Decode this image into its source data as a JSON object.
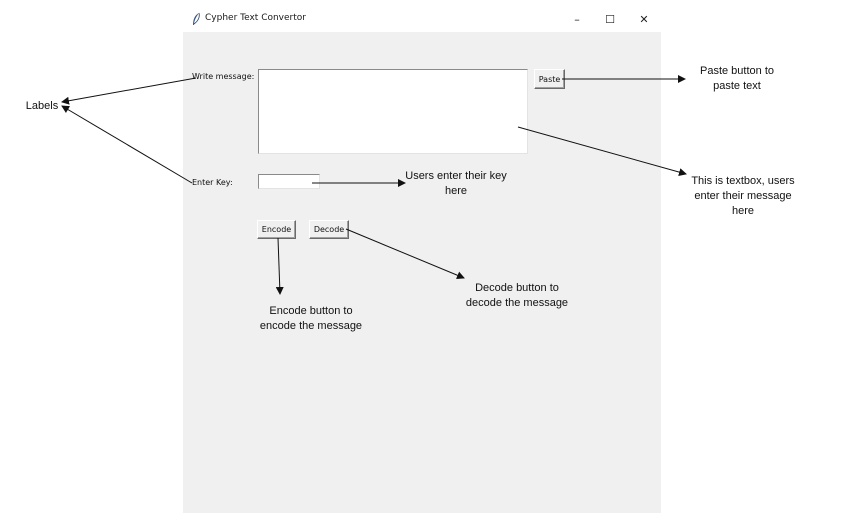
{
  "window": {
    "title": "Cypher Text Convertor",
    "minimize_glyph": "–",
    "maximize_glyph": "☐",
    "close_glyph": "✕"
  },
  "form": {
    "message_label": "Write message:",
    "key_label": "Enter Key:",
    "message_value": "",
    "key_value": "",
    "paste_label": "Paste",
    "encode_label": "Encode",
    "decode_label": "Decode"
  },
  "annotations": {
    "labels": "Labels",
    "paste_note_1": "Paste button to",
    "paste_note_2": "paste text",
    "textbox_note_1": "This is textbox, users",
    "textbox_note_2": "enter their message",
    "textbox_note_3": "here",
    "key_note_1": "Users enter their key",
    "key_note_2": "here",
    "encode_note_1": "Encode button to",
    "encode_note_2": "encode the message",
    "decode_note_1": "Decode button to",
    "decode_note_2": "decode the message"
  },
  "colors": {
    "client_bg": "#f0f0f0",
    "annotation": "#111111"
  }
}
